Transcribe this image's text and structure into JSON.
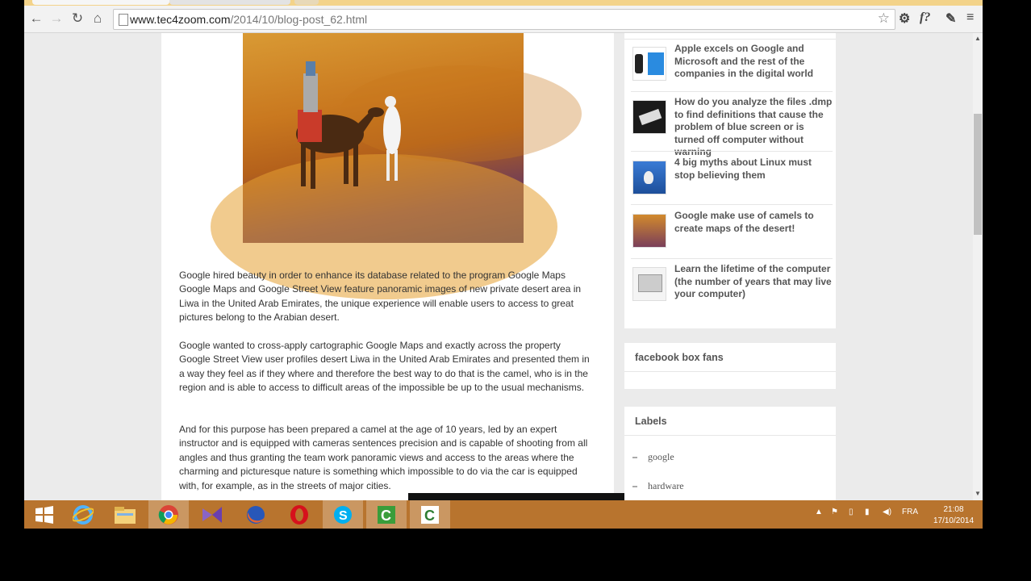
{
  "browser": {
    "url_host": "www.tec4zoom.com",
    "url_path": "/2014/10/blog-post_62.html",
    "extension_label": "f?"
  },
  "post": {
    "image_alt": "camel with street view camera in desert",
    "paragraphs": [
      "Google hired beauty in order to enhance its database related to the program Google Maps Google Maps and Google Street View feature panoramic images of new private desert area in Liwa in the United Arab Emirates, the unique experience will enable users to access to great pictures belong to the Arabian desert.",
      "Google wanted to cross-apply cartographic Google Maps and exactly across the property Google Street View user profiles desert Liwa in the United Arab Emirates and presented them in a way they feel as if they where and therefore the best way to do that is the camel, who is in the region and is able to access to difficult areas of the impossible be up to the usual mechanisms.",
      "And for this purpose has been prepared a camel at the age of 10 years, led by an expert instructor and is equipped with cameras sentences precision and is capable of shooting from all angles and thus granting the team work panoramic views and access to the areas where the charming and picturesque nature is something which impossible to do via the car is equipped with, for example, as in the streets of major cities."
    ]
  },
  "popular_posts": [
    {
      "title": "Apple excels on Google and Microsoft and the rest of the companies in the digital world"
    },
    {
      "title": "How do you analyze the files .dmp to find definitions that cause the problem of blue screen or is turned off computer without warning"
    },
    {
      "title": "4 big myths about Linux must stop believing them"
    },
    {
      "title": "Google make use of camels to create maps of the desert!"
    },
    {
      "title": "Learn the lifetime of the computer (the number of years that may live your computer)"
    }
  ],
  "facebook_widget": {
    "title": "facebook box fans"
  },
  "labels_widget": {
    "title": "Labels",
    "items": [
      "google",
      "hardware"
    ]
  },
  "taskbar": {
    "apps": [
      "windows-start",
      "internet-explorer",
      "file-explorer",
      "chrome",
      "visual-studio",
      "firefox",
      "opera",
      "skype",
      "camtasia-recorder",
      "camtasia-studio"
    ],
    "language": "FRA",
    "time": "21:08",
    "date": "17/10/2014"
  },
  "colors": {
    "taskbar": "#b8742e",
    "tabstrip": "#f3d38a"
  }
}
